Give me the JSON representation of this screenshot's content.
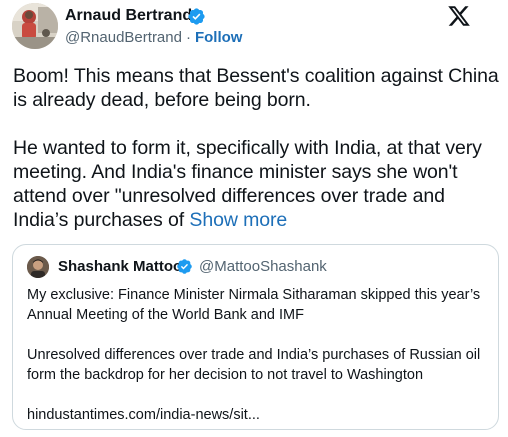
{
  "author": {
    "name": "Arnaud Bertrand",
    "handle": "@RnaudBertrand",
    "separator": "·",
    "follow_label": "Follow"
  },
  "tweet": {
    "paragraph_1": "Boom! This means that Bessent's coalition against China is already dead, before being born.",
    "paragraph_2": "He wanted to form it, specifically with India, at that very meeting. And India's finance minister says she won't attend over \"unresolved differences over trade and India’s purchases of",
    "show_more_label": "Show more"
  },
  "quote": {
    "name": "Shashank Mattoo",
    "handle": "@MattooShashank",
    "paragraph_1": "My exclusive: Finance Minister Nirmala Sitharaman skipped this year’s Annual Meeting of the World Bank and IMF",
    "paragraph_2": "Unresolved differences over trade and India’s purchases of Russian oil form the backdrop for her decision to not travel to Washington",
    "link_text": "hindustantimes.com/india-news/sit..."
  },
  "icons": {
    "verified": "verified-badge-icon",
    "platform": "x-logo-icon"
  },
  "colors": {
    "link": "#1d6fb8",
    "verified": "#1d9bf0",
    "secondary_text": "#536471",
    "border": "#cfd9de"
  }
}
